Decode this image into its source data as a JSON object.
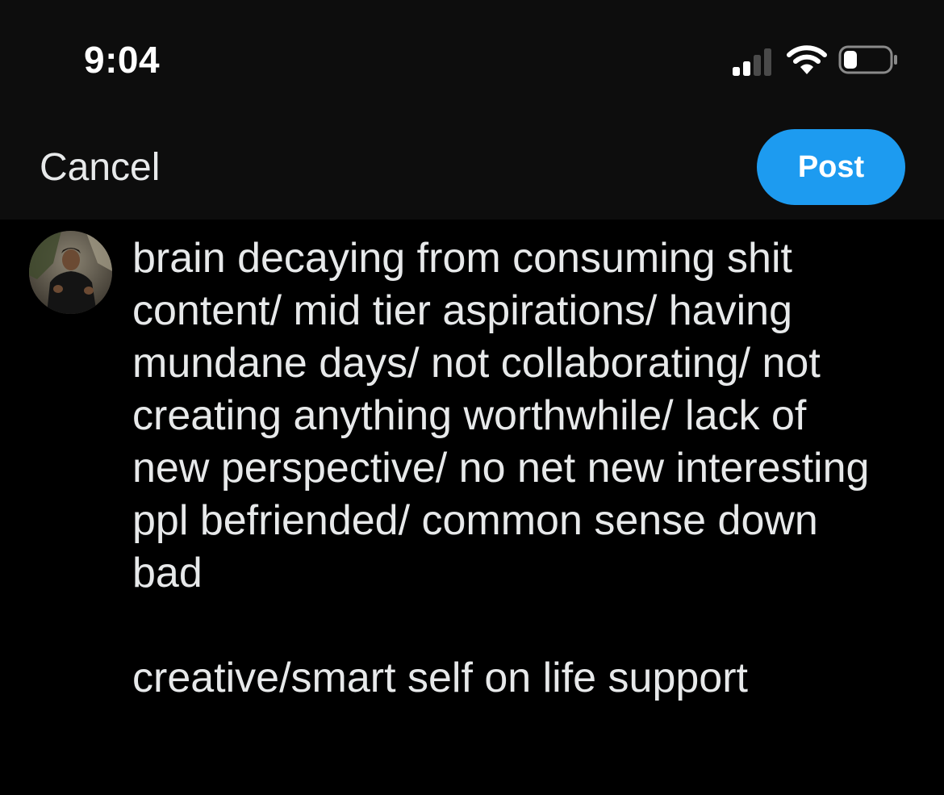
{
  "status_bar": {
    "time": "9:04",
    "icons": [
      "cellular-signal-icon",
      "wifi-icon",
      "battery-icon"
    ],
    "battery_level": 0.25
  },
  "nav": {
    "cancel_label": "Cancel",
    "post_label": "Post",
    "post_color": "#1d9bf0"
  },
  "compose": {
    "avatar_icon": "user-avatar",
    "lines": [
      "brain decaying from consuming shit",
      "content/ mid tier aspirations/ having",
      "mundane days/ not collaborating/ not",
      "creating anything worthwhile/ lack of",
      "new perspective/ no net new interesting",
      "ppl befriended/ common sense down",
      "bad",
      "",
      "creative/smart self on life support"
    ]
  },
  "colors": {
    "background": "#000000",
    "header_background": "#0d0d0d",
    "text": "#e7e9ea",
    "accent": "#1d9bf0"
  }
}
